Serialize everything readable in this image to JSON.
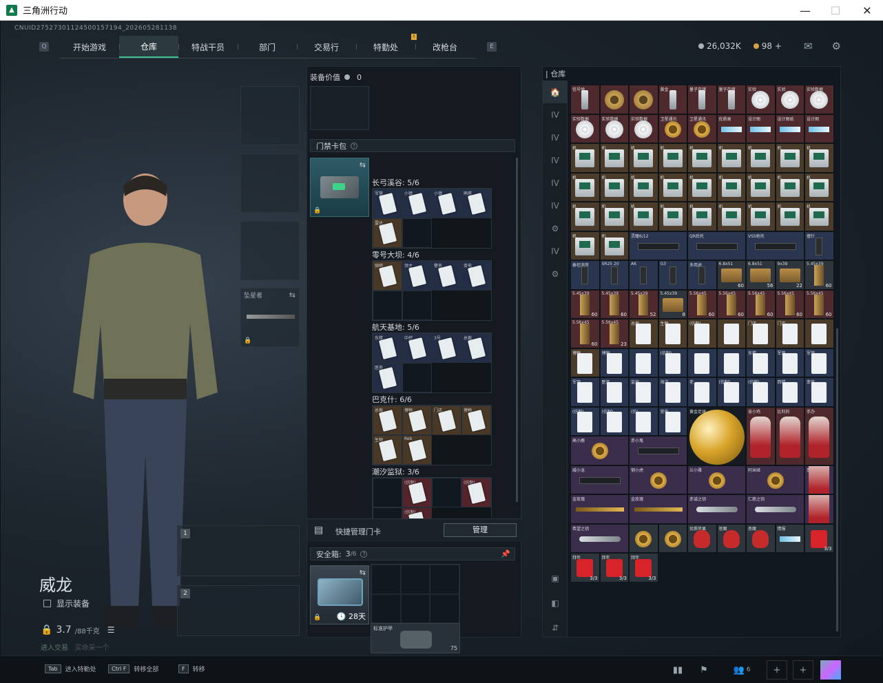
{
  "window": {
    "title": "三角洲行动",
    "minimize": "—",
    "maximize": "☐",
    "close": "✕"
  },
  "uid": "CNUID27527301124500157194_202605281138",
  "nav": {
    "left_key": "Q",
    "right_key": "E",
    "badge": "!",
    "tabs": [
      {
        "label": "开始游戏"
      },
      {
        "label": "仓库"
      },
      {
        "label": "特战干员"
      },
      {
        "label": "部门"
      },
      {
        "label": "交易行"
      },
      {
        "label": "特勤处"
      },
      {
        "label": "改枪台"
      }
    ],
    "active_tab": "仓库"
  },
  "currency": {
    "havoc": "26,032K",
    "coupon": "98",
    "plus": "+"
  },
  "character": {
    "name": "威龙",
    "show_equipment": "显示装备",
    "weight": "3.7",
    "weight_max": "/88千克",
    "status_a": "进入交易",
    "status_b": "买命采一个"
  },
  "equip_slots": {
    "melee_label": "坠星者",
    "weapon1_num": "1",
    "weapon2_num": "2"
  },
  "middle": {
    "equip_value_label": "装备价值",
    "equip_value": "0",
    "keycard_section": "门禁卡包",
    "areas": [
      {
        "name": "长弓溪谷: 5/6",
        "cells": [
          {
            "t": "军营",
            "c": "b"
          },
          {
            "t": "小镇",
            "c": "b"
          },
          {
            "t": "小镇",
            "c": "b"
          },
          {
            "t": "哨塔",
            "c": "b"
          },
          {
            "t": "雷达",
            "c": "o"
          },
          {
            "t": "",
            "c": "e"
          },
          {
            "t": "",
            "c": "h"
          },
          {
            "t": "",
            "c": "h"
          }
        ]
      },
      {
        "name": "零号大坝: 4/6",
        "cells": [
          {
            "t": "骑哨",
            "c": "o"
          },
          {
            "t": "领主",
            "c": "b"
          },
          {
            "t": "警务",
            "c": "b"
          },
          {
            "t": "变电",
            "c": "b"
          },
          {
            "t": "",
            "c": "e"
          },
          {
            "t": "",
            "c": "e"
          },
          {
            "t": "",
            "c": "h"
          },
          {
            "t": "",
            "c": "h"
          }
        ]
      },
      {
        "name": "航天基地: 5/6",
        "cells": [
          {
            "t": "东楼",
            "c": "b"
          },
          {
            "t": "中控",
            "c": "b"
          },
          {
            "t": "3号",
            "c": "b"
          },
          {
            "t": "总裁",
            "c": "b"
          },
          {
            "t": "医务",
            "c": "b"
          },
          {
            "t": "",
            "c": "e"
          },
          {
            "t": "",
            "c": "h"
          },
          {
            "t": "",
            "c": "h"
          }
        ]
      },
      {
        "name": "巴克什: 6/6",
        "cells": [
          {
            "t": "总裁",
            "c": "o"
          },
          {
            "t": "博物",
            "c": "o"
          },
          {
            "t": "门店",
            "c": "o"
          },
          {
            "t": "博物",
            "c": "o"
          },
          {
            "t": "生物",
            "c": "o"
          },
          {
            "t": "Reb",
            "c": "o"
          },
          {
            "t": "",
            "c": "h"
          },
          {
            "t": "",
            "c": "h"
          }
        ]
      },
      {
        "name": "潮汐监狱: 3/6",
        "cells": [
          {
            "t": "",
            "c": "e"
          },
          {
            "t": "(仿制)",
            "c": "r"
          },
          {
            "t": "",
            "c": "e"
          },
          {
            "t": "(仿制)",
            "c": "r"
          },
          {
            "t": "",
            "c": "e"
          },
          {
            "t": "(仿制)",
            "c": "r"
          },
          {
            "t": "",
            "c": "h"
          },
          {
            "t": "",
            "c": "h"
          }
        ]
      }
    ],
    "quick_manage": "快捷管理门卡",
    "manage_btn": "管理",
    "safe_label": "安全箱:",
    "safe_count": "3",
    "safe_total": "/6",
    "safe_days": "28天",
    "vest_label": "标准护甲",
    "vest_count": "75"
  },
  "stash": {
    "title": "仓库",
    "sidetabs": [
      "🏠",
      "IV",
      "IV",
      "IV",
      "IV",
      "IV",
      "⚙",
      "IV",
      "⚙"
    ],
    "items": [
      {
        "l": "信号弹",
        "s": "usb",
        "b": "r"
      },
      {
        "l": "",
        "s": "gear",
        "b": "r"
      },
      {
        "l": "",
        "s": "gear",
        "b": "r"
      },
      {
        "l": "黄金",
        "s": "usb",
        "b": "r"
      },
      {
        "l": "量子存储",
        "s": "usb",
        "b": "r"
      },
      {
        "l": "量子存储",
        "s": "usb",
        "b": "r"
      },
      {
        "l": "实验",
        "s": "disc",
        "b": "r"
      },
      {
        "l": "实验",
        "s": "disc",
        "b": "r"
      },
      {
        "l": "实验数据",
        "s": "disc",
        "b": "r"
      },
      {
        "l": "实验数据",
        "s": "disc",
        "b": "r"
      },
      {
        "l": "实验数据",
        "s": "disc",
        "b": "r"
      },
      {
        "l": "实验数据",
        "s": "disc",
        "b": "r"
      },
      {
        "l": "卫星通讯",
        "s": "ring",
        "b": "r"
      },
      {
        "l": "卫星通讯",
        "s": "ring",
        "b": "r"
      },
      {
        "l": "优质高",
        "s": "blade",
        "b": "r"
      },
      {
        "l": "设计图",
        "s": "blade",
        "b": "r"
      },
      {
        "l": "设计图纸",
        "s": "blade",
        "b": "r"
      },
      {
        "l": "设计图",
        "s": "blade",
        "b": "r"
      },
      {
        "l": "机",
        "s": "pc",
        "b": "o"
      },
      {
        "l": "机",
        "s": "pc",
        "b": "o"
      },
      {
        "l": "机",
        "s": "pc",
        "b": "o"
      },
      {
        "l": "机",
        "s": "pc",
        "b": "o"
      },
      {
        "l": "机",
        "s": "pc",
        "b": "o"
      },
      {
        "l": "机",
        "s": "pc",
        "b": "o"
      },
      {
        "l": "机",
        "s": "pc",
        "b": "o"
      },
      {
        "l": "机",
        "s": "pc",
        "b": "o"
      },
      {
        "l": "机",
        "s": "pc",
        "b": "o"
      },
      {
        "l": "机",
        "s": "pc",
        "b": "o"
      },
      {
        "l": "机",
        "s": "pc",
        "b": "o"
      },
      {
        "l": "机",
        "s": "pc",
        "b": "o"
      },
      {
        "l": "机",
        "s": "pc",
        "b": "o"
      },
      {
        "l": "机",
        "s": "pc",
        "b": "o"
      },
      {
        "l": "机",
        "s": "pc",
        "b": "o"
      },
      {
        "l": "机",
        "s": "pc",
        "b": "o"
      },
      {
        "l": "机",
        "s": "pc",
        "b": "o"
      },
      {
        "l": "机",
        "s": "pc",
        "b": "o"
      },
      {
        "l": "机",
        "s": "pc",
        "b": "o"
      },
      {
        "l": "机",
        "s": "pc",
        "b": "o"
      },
      {
        "l": "机",
        "s": "pc",
        "b": "o"
      },
      {
        "l": "机",
        "s": "pc",
        "b": "o"
      },
      {
        "l": "机",
        "s": "pc",
        "b": "o"
      },
      {
        "l": "机",
        "s": "pc",
        "b": "o"
      },
      {
        "l": "机",
        "s": "pc",
        "b": "o"
      },
      {
        "l": "机",
        "s": "pc",
        "b": "o"
      },
      {
        "l": "机",
        "s": "pc",
        "b": "o"
      },
      {
        "l": "机",
        "s": "pc",
        "b": "o"
      },
      {
        "l": "机",
        "s": "pc",
        "b": "o"
      },
      {
        "l": "灵瞳6/12",
        "s": "gun",
        "b": "b",
        "w": 2
      },
      {
        "l": "QR后托",
        "s": "gun",
        "b": "b",
        "w": 2
      },
      {
        "l": "VSS枪托",
        "s": "gun",
        "b": "b",
        "w": 2
      },
      {
        "l": "撞针",
        "s": "mag",
        "b": "b"
      },
      {
        "l": "泰坦消音",
        "s": "mag",
        "b": "b"
      },
      {
        "l": "SR25 20",
        "s": "mag",
        "b": "b"
      },
      {
        "l": "AK",
        "s": "mag",
        "b": "b"
      },
      {
        "l": "G3",
        "s": "mag",
        "b": "b"
      },
      {
        "l": "多用途",
        "s": "mag",
        "b": "b"
      },
      {
        "l": "6.8x51",
        "s": "ammo",
        "b": "g",
        "c": "60"
      },
      {
        "l": "6.8x51",
        "s": "ammo",
        "b": "g",
        "c": "56"
      },
      {
        "l": "9x39",
        "s": "ammo",
        "b": "g",
        "c": "22"
      },
      {
        "l": "5.45x39",
        "s": "ammo2",
        "b": "g",
        "c": "60"
      },
      {
        "l": "5.45x39",
        "s": "ammo2",
        "b": "r",
        "c": "60"
      },
      {
        "l": "5.45x39",
        "s": "ammo2",
        "b": "r",
        "c": "60"
      },
      {
        "l": "5.45x39",
        "s": "ammo2",
        "b": "r",
        "c": "52"
      },
      {
        "l": "5.45x39",
        "s": "ammo",
        "b": "g",
        "c": "8"
      },
      {
        "l": "5.56x45",
        "s": "ammo2",
        "b": "r",
        "c": "60"
      },
      {
        "l": "5.56x45",
        "s": "ammo2",
        "b": "r",
        "c": "60"
      },
      {
        "l": "5.56x45",
        "s": "ammo2",
        "b": "r",
        "c": "60"
      },
      {
        "l": "5.56x45",
        "s": "ammo2",
        "b": "r",
        "c": "60"
      },
      {
        "l": "5.56x45",
        "s": "ammo2",
        "b": "r",
        "c": "60"
      },
      {
        "l": "5.56x45",
        "s": "ammo2",
        "b": "r",
        "c": "60"
      },
      {
        "l": "5.56x45",
        "s": "ammo2",
        "b": "r",
        "c": "23"
      },
      {
        "l": "总裁",
        "s": "cardw",
        "b": "o"
      },
      {
        "l": "生物",
        "s": "cardw",
        "b": "o"
      },
      {
        "l": "(仿制)",
        "s": "cardw",
        "b": "o"
      },
      {
        "l": "",
        "s": "cardw",
        "b": "o"
      },
      {
        "l": "门店",
        "s": "cardw",
        "b": "o"
      },
      {
        "l": "门店",
        "s": "cardw",
        "b": "o"
      },
      {
        "l": "",
        "s": "cardw",
        "b": "o"
      },
      {
        "l": "博物",
        "s": "cardw",
        "b": "o"
      },
      {
        "l": "博物",
        "s": "cardw",
        "b": "b"
      },
      {
        "l": "",
        "s": "cardw",
        "b": "b"
      },
      {
        "l": "(仿制)",
        "s": "cardw",
        "b": "b"
      },
      {
        "l": "",
        "s": "cardw",
        "b": "b"
      },
      {
        "l": "",
        "s": "cardw",
        "b": "b"
      },
      {
        "l": "东楼",
        "s": "cardw",
        "b": "b"
      },
      {
        "l": "军营",
        "s": "cardw",
        "b": "b"
      },
      {
        "l": "军营",
        "s": "cardw",
        "b": "b"
      },
      {
        "l": "军营",
        "s": "cardw",
        "b": "b"
      },
      {
        "l": "医务",
        "s": "cardw",
        "b": "b"
      },
      {
        "l": "监控",
        "s": "cardw",
        "b": "b"
      },
      {
        "l": "海洋",
        "s": "cardw",
        "b": "b"
      },
      {
        "l": "老",
        "s": "cardw",
        "b": "b"
      },
      {
        "l": "(仿制)",
        "s": "cardw",
        "b": "b"
      },
      {
        "l": "(仿制)",
        "s": "cardw",
        "b": "b"
      },
      {
        "l": "西楼",
        "s": "cardw",
        "b": "b"
      },
      {
        "l": "变电",
        "s": "cardw",
        "b": "b"
      },
      {
        "l": "(仿制)",
        "s": "cardw",
        "b": "b"
      },
      {
        "l": "(仿制)",
        "s": "cardw",
        "b": "b"
      },
      {
        "l": "(仿)",
        "s": "cardw",
        "b": "b"
      },
      {
        "l": "变电",
        "s": "cardw",
        "b": "b"
      },
      {
        "l": "黄金足球",
        "s": "ball",
        "b": "e",
        "w": 2,
        "h": 2
      },
      {
        "l": "肯小鸡",
        "s": "figure",
        "b": "r",
        "h": 2
      },
      {
        "l": "比利的",
        "s": "figure",
        "b": "r",
        "h": 2
      },
      {
        "l": "手办",
        "s": "figure",
        "b": "r",
        "h": 2
      },
      {
        "l": "高小鹿",
        "s": "ring",
        "b": "p",
        "w": 2
      },
      {
        "l": "赤小鬼",
        "s": "gun",
        "b": "p",
        "w": 2
      },
      {
        "l": "威小龙",
        "s": "gun",
        "b": "p",
        "w": 2
      },
      {
        "l": "钢小虎",
        "s": "ring",
        "b": "p",
        "w": 2
      },
      {
        "l": "兰小雅",
        "s": "ring",
        "b": "p",
        "w": 2
      },
      {
        "l": "阿米娅",
        "s": "ring",
        "b": "p",
        "w": 2
      },
      {
        "l": "贵小妹",
        "s": "figure",
        "b": "p"
      },
      {
        "l": "金玫瑰",
        "s": "rose",
        "b": "p",
        "w": 2
      },
      {
        "l": "金玫瑰",
        "s": "rose",
        "b": "p",
        "w": 2
      },
      {
        "l": "赤诚之钥",
        "s": "key",
        "b": "p",
        "w": 2
      },
      {
        "l": "仁慈之钥",
        "s": "key",
        "b": "p",
        "w": 2
      },
      {
        "l": "",
        "s": "figure",
        "b": "p"
      },
      {
        "l": "希望之钥",
        "s": "key",
        "b": "p",
        "w": 2
      },
      {
        "l": "",
        "s": "ring",
        "b": "g"
      },
      {
        "l": "",
        "s": "ring",
        "b": "g"
      },
      {
        "l": "优质苹果",
        "s": "skull",
        "b": "g"
      },
      {
        "l": "恶魔",
        "s": "skull",
        "b": "g"
      },
      {
        "l": "恶魔",
        "s": "skull",
        "b": "g"
      },
      {
        "l": "情报",
        "s": "blade",
        "b": "g"
      },
      {
        "l": "",
        "s": "redenv",
        "b": "g",
        "c": "3/3"
      },
      {
        "l": "拜年",
        "s": "redenv",
        "b": "g",
        "c": "3/3"
      },
      {
        "l": "拜年",
        "s": "redenv",
        "b": "g",
        "c": "3/3"
      },
      {
        "l": "拜年",
        "s": "redenv",
        "b": "g",
        "c": "3/3"
      }
    ]
  },
  "bottom": {
    "hints": [
      {
        "key": "Tab",
        "text": "进入特勤处"
      },
      {
        "key": "Ctrl F",
        "text": "转移全部"
      },
      {
        "key": "F",
        "text": "转移"
      }
    ],
    "friends": "6"
  }
}
